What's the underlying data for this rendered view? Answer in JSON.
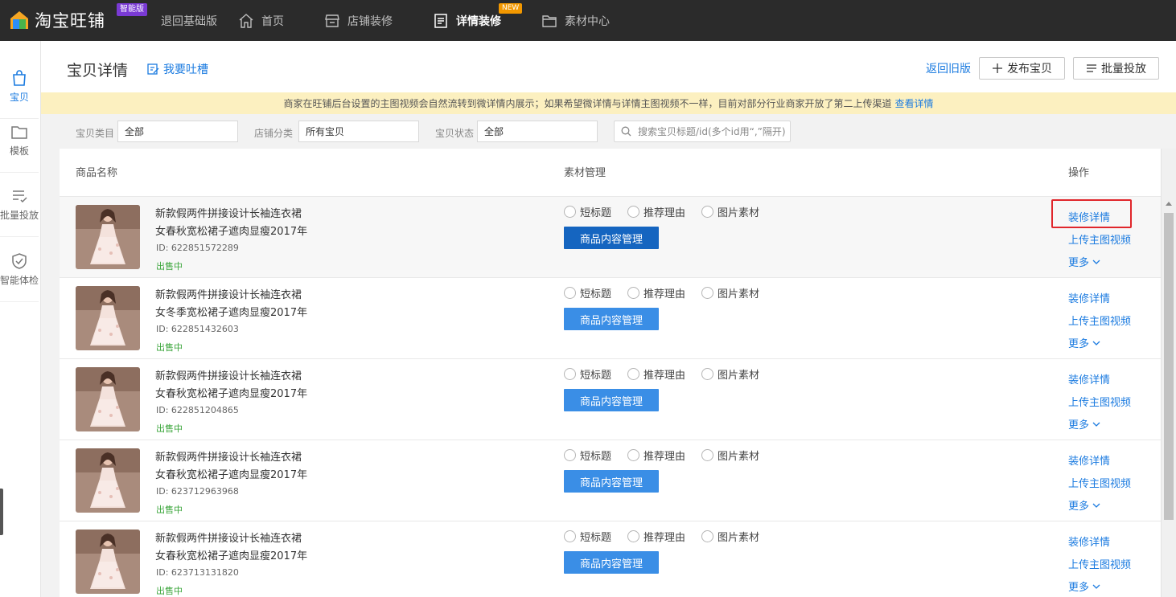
{
  "topbar": {
    "logo_text": "淘宝旺铺",
    "badge": "智能版",
    "nav": [
      {
        "label": "退回基础版",
        "icon": "none"
      },
      {
        "label": "首页",
        "icon": "home-icon"
      },
      {
        "label": "店铺装修",
        "icon": "store-icon"
      },
      {
        "label": "详情装修",
        "icon": "document-icon",
        "active": true,
        "badge": "NEW"
      },
      {
        "label": "素材中心",
        "icon": "folder-icon"
      }
    ]
  },
  "sidebar": {
    "items": [
      {
        "label": "宝贝",
        "icon": "shopping-bag-icon",
        "active": true
      },
      {
        "label": "模板",
        "icon": "folder-icon"
      },
      {
        "label": "批量投放",
        "icon": "list-check-icon"
      },
      {
        "label": "智能体检",
        "icon": "shield-check-icon"
      }
    ]
  },
  "header": {
    "title": "宝贝详情",
    "feedback": "我要吐槽",
    "back_old": "返回旧版",
    "publish_btn": "发布宝贝",
    "batch_btn": "批量投放"
  },
  "notice": {
    "text": "商家在旺铺后台设置的主图视频会自然流转到微详情内展示；如果希望微详情与详情主图视频不一样，目前对部分行业商家开放了第二上传渠道",
    "link": "查看详情"
  },
  "filters": {
    "category_label": "宝贝类目",
    "category_value": "全部",
    "shop_label": "店铺分类",
    "shop_value": "所有宝贝",
    "status_label": "宝贝状态",
    "status_value": "全部",
    "search_placeholder": "搜索宝贝标题/id(多个id用“,”隔开)"
  },
  "table": {
    "columns": [
      "商品名称",
      "素材管理",
      "操作"
    ],
    "radio_labels": [
      "短标题",
      "推荐理由",
      "图片素材"
    ],
    "manage_label": "商品内容管理",
    "op_labels": [
      "装修详情",
      "上传主图视频",
      "更多"
    ],
    "rows": [
      {
        "name1": "新款假两件拼接设计长袖连衣裙",
        "name2": "女春秋宽松裙子遮肉显瘦2017年",
        "id": "ID: 622851572289",
        "status": "出售中"
      },
      {
        "name1": "新款假两件拼接设计长袖连衣裙",
        "name2": "女冬季宽松裙子遮肉显瘦2017年",
        "id": "ID: 622851432603",
        "status": "出售中"
      },
      {
        "name1": "新款假两件拼接设计长袖连衣裙",
        "name2": "女春秋宽松裙子遮肉显瘦2017年",
        "id": "ID: 622851204865",
        "status": "出售中"
      },
      {
        "name1": "新款假两件拼接设计长袖连衣裙",
        "name2": "女春秋宽松裙子遮肉显瘦2017年",
        "id": "ID: 623712963968",
        "status": "出售中"
      },
      {
        "name1": "新款假两件拼接设计长袖连衣裙",
        "name2": "女春秋宽松裙子遮肉显瘦2017年",
        "id": "ID: 623713131820",
        "status": "出售中"
      }
    ]
  },
  "colors": {
    "topbar_bg": "#2b2b2b",
    "accent": "#1b7be0",
    "button_blue": "#3a8ee6",
    "button_blue_active": "#1565c0",
    "notice_bg": "#fcf0c0",
    "status_green": "#3aa53a",
    "highlight_red": "#e0262b"
  }
}
